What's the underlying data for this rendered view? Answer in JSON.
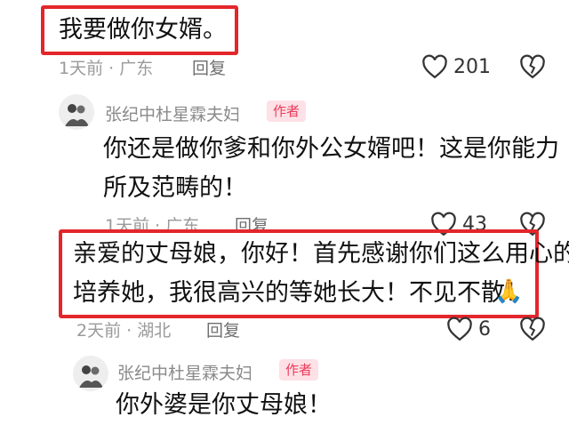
{
  "comments": [
    {
      "text": "我要做你女婿。",
      "meta": "1天前 · 广东",
      "reply_label": "回复",
      "likes": "201",
      "replies": [
        {
          "author": "张纪中杜星霖夫妇",
          "badge": "作者",
          "lines": [
            "你还是做你爹和你外公女婿吧！这是你能力",
            "所及范畴的！"
          ],
          "meta": "1天前 · 广东",
          "reply_label": "回复",
          "likes": "43"
        }
      ]
    },
    {
      "lines": [
        "亲爱的丈母娘，你好！首先感谢你们这么用心的",
        "培养她，我很高兴的等她长大！不见不散！"
      ],
      "emoji": "🙏",
      "meta": "2天前 · 湖北",
      "reply_label": "回复",
      "likes": "6",
      "replies": [
        {
          "author": "张纪中杜星霖夫妇",
          "badge": "作者",
          "lines": [
            "你外婆是你丈母娘！"
          ]
        }
      ]
    }
  ],
  "colors": {
    "highlight": "#e3262b",
    "badge_text": "#ec3b5b",
    "badge_bg": "#fde1e6"
  },
  "icons": [
    "heart-icon",
    "dislike-heart-icon",
    "praying-hands-emoji"
  ]
}
